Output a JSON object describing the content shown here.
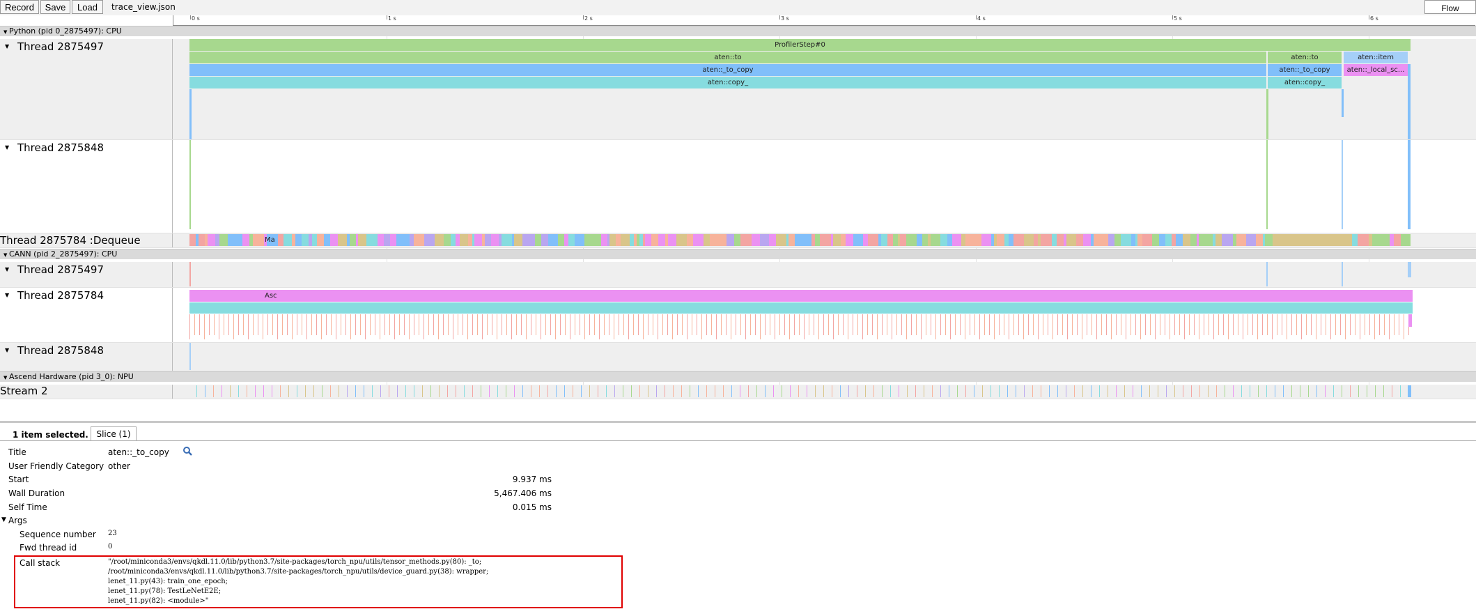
{
  "toolbar": {
    "record": "Record",
    "save": "Save",
    "load": "Load",
    "file": "trace_view.json",
    "flow": "Flow events"
  },
  "ruler": {
    "labels": [
      "0 s",
      "1 s",
      "2 s",
      "3 s",
      "4 s",
      "5 s",
      "6 s"
    ]
  },
  "processes": {
    "python": "Python (pid 0_2875497): CPU",
    "cann": "CANN (pid 2_2875497): CPU",
    "ascend": "Ascend Hardware (pid 3_0): NPU"
  },
  "threads": {
    "py1": "Thread 2875497",
    "py2": "Thread 2875848",
    "py3": "Thread 2875784 :Dequeue",
    "cann1": "Thread 2875497",
    "cann2": "Thread 2875784",
    "cann3": "Thread 2875848",
    "stream": "Stream 2"
  },
  "slices": {
    "profiler_step": "ProfilerStep#0",
    "aten_to": "aten::to",
    "aten_to_copy": "aten::_to_copy",
    "aten_copy": "aten::copy_",
    "aten_to_2": "aten::to",
    "aten_to_copy_2": "aten::_to_copy",
    "aten_copy_2": "aten::copy_",
    "aten_item": "aten::item",
    "aten_local": "aten::_local_sc...",
    "dequeue_ma": "Ma",
    "cann_asc": "Asc"
  },
  "colors": {
    "green": "#a7d88e",
    "blue": "#81bffa",
    "cyan": "#86dcdf",
    "pink": "#eb91f2",
    "salmon": "#f3a5a2",
    "lightblue": "#a5cff8"
  },
  "details": {
    "selected": "1 item selected.",
    "tab": "Slice (1)",
    "title_label": "Title",
    "title_value": "aten::_to_copy",
    "ufc_label": "User Friendly Category",
    "ufc_value": "other",
    "start_label": "Start",
    "start_value": "9.937 ms",
    "wall_label": "Wall Duration",
    "wall_value": "5,467.406 ms",
    "self_label": "Self Time",
    "self_value": "0.015 ms",
    "args_label": "Args",
    "seq_label": "Sequence number",
    "seq_value": "23",
    "fwd_label": "Fwd thread id",
    "fwd_value": "0",
    "call_label": "Call stack",
    "call_lines": [
      "\"/root/miniconda3/envs/qkdl.11.0/lib/python3.7/site-packages/torch_npu/utils/tensor_methods.py(80): _to;",
      " /root/miniconda3/envs/qkdl.11.0/lib/python3.7/site-packages/torch_npu/utils/device_guard.py(38): wrapper;",
      " lenet_11.py(43): train_one_epoch;",
      " lenet_11.py(78): TestLeNetE2E;",
      " lenet_11.py(82): <module>\""
    ]
  }
}
